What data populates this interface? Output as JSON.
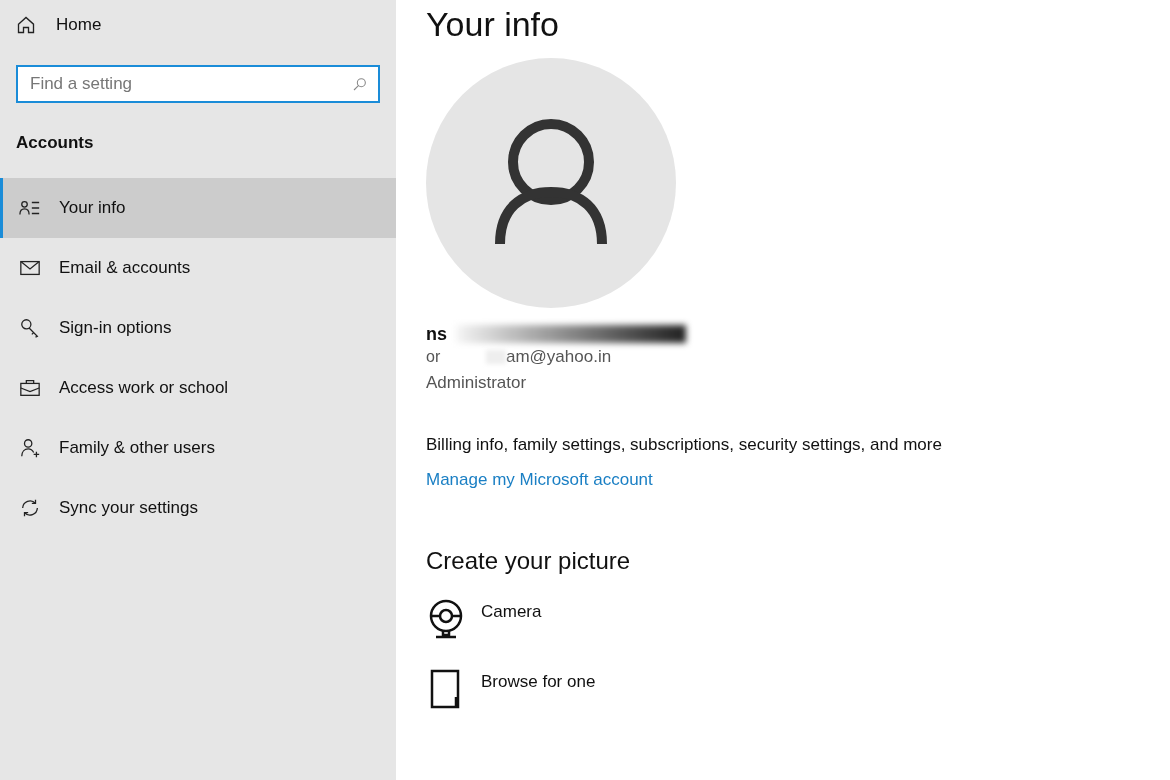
{
  "sidebar": {
    "home": "Home",
    "search": {
      "placeholder": "Find a setting"
    },
    "section": "Accounts",
    "items": [
      {
        "label": "Your info",
        "selected": true
      },
      {
        "label": "Email & accounts",
        "selected": false
      },
      {
        "label": "Sign-in options",
        "selected": false
      },
      {
        "label": "Access work or school",
        "selected": false
      },
      {
        "label": "Family & other users",
        "selected": false
      },
      {
        "label": "Sync your settings",
        "selected": false
      }
    ]
  },
  "main": {
    "title": "Your info",
    "name_fragment": "ns",
    "account_fragment": "or",
    "email_fragment": "am@yahoo.in",
    "role": "Administrator",
    "description": "Billing info, family settings, subscriptions, security settings, and more",
    "link": "Manage my Microsoft account",
    "picture_heading": "Create your picture",
    "picture_options": [
      {
        "label": "Camera"
      },
      {
        "label": "Browse for one"
      }
    ]
  }
}
